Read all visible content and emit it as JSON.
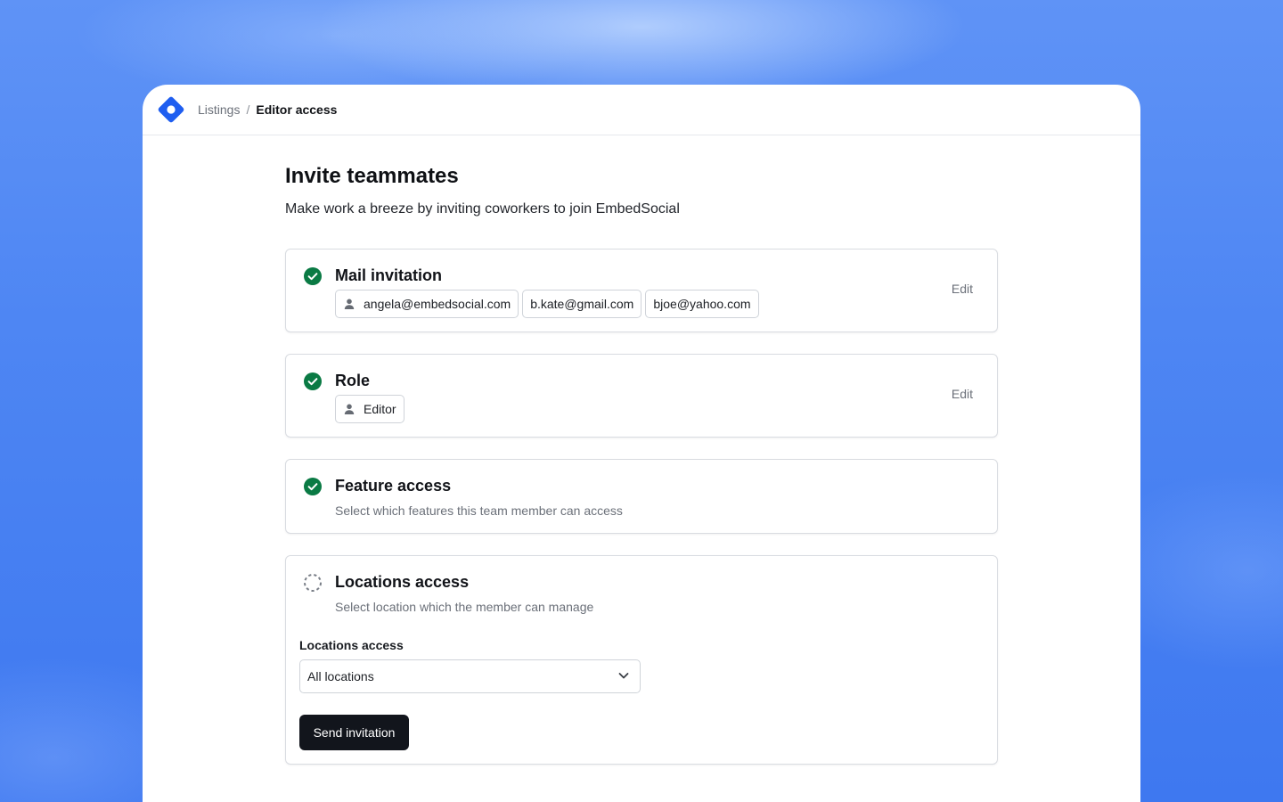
{
  "breadcrumb": {
    "parent": "Listings",
    "separator": "/",
    "current": "Editor access"
  },
  "header": {
    "title": "Invite teammates",
    "subtitle": "Make work a breeze by inviting coworkers to join EmbedSocial"
  },
  "cards": {
    "mail": {
      "title": "Mail invitation",
      "status": "complete",
      "edit_label": "Edit",
      "emails": [
        "angela@embedsocial.com",
        "b.kate@gmail.com",
        "bjoe@yahoo.com"
      ]
    },
    "role": {
      "title": "Role",
      "status": "complete",
      "edit_label": "Edit",
      "value": "Editor"
    },
    "feature": {
      "title": "Feature access",
      "status": "complete",
      "description": "Select which features this team member can access"
    },
    "locations": {
      "title": "Locations access",
      "status": "in-progress",
      "description": "Select location which the member can manage",
      "field_label": "Locations access",
      "selected_option": "All locations",
      "submit_label": "Send invitation"
    }
  },
  "icons": {
    "logo": "diamond-logo-icon",
    "complete": "check-circle-icon",
    "in_progress": "dashed-circle-icon",
    "user": "person-icon",
    "dropdown": "chevron-down-icon"
  },
  "colors": {
    "brand": "#2563eb",
    "success": "#0a7a44",
    "primary_button": "#12151c",
    "background": "#4d86f4"
  }
}
